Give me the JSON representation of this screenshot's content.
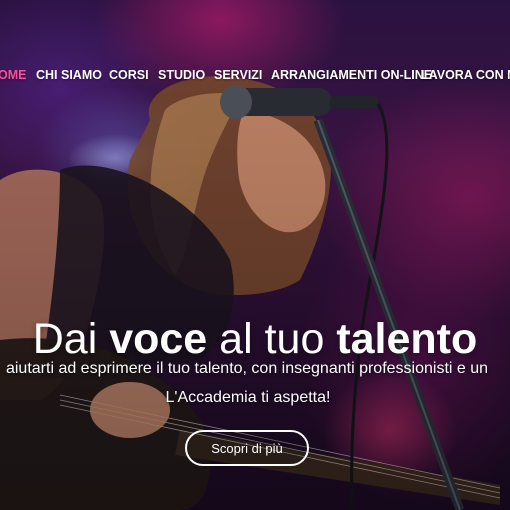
{
  "nav": {
    "items": [
      {
        "label": "HOME"
      },
      {
        "label": "CHI SIAMO"
      },
      {
        "label": "CORSI"
      },
      {
        "label": "STUDIO"
      },
      {
        "label": "SERVIZI"
      },
      {
        "label": "ARRANGIAMENTI ON-LINE"
      },
      {
        "label": "LAVORA CON NOI"
      }
    ],
    "active_color": "#ff4f9a"
  },
  "hero": {
    "title_part1": "Dai ",
    "title_part2": "voce",
    "title_part3": " al tuo ",
    "title_part4": "talento",
    "subtitle_line1": "aiutarti ad esprimere il tuo talento, con insegnanti professionisti e un",
    "subtitle_line2": "L'Accademia ti aspetta!",
    "cta_label": "Scopri di più"
  },
  "colors": {
    "text": "#ffffff",
    "background": "#2a1240"
  }
}
